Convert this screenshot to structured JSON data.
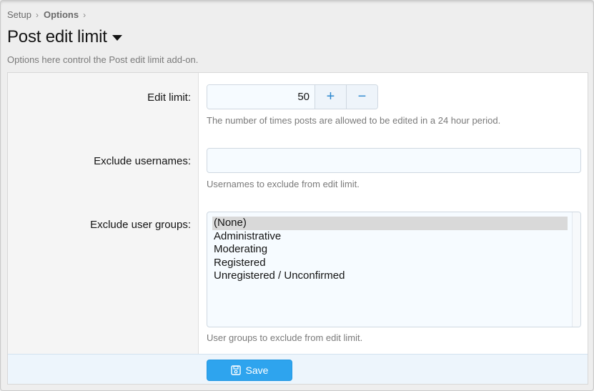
{
  "breadcrumb": {
    "items": [
      "Setup",
      "Options"
    ],
    "separator": "›"
  },
  "header": {
    "title": "Post edit limit",
    "description": "Options here control the Post edit limit add-on."
  },
  "options": {
    "edit_limit": {
      "label": "Edit limit:",
      "value": "50",
      "increment_label": "+",
      "decrement_label": "−",
      "explain": "The number of times posts are allowed to be edited in a 24 hour period."
    },
    "exclude_usernames": {
      "label": "Exclude usernames:",
      "value": "",
      "placeholder": "",
      "explain": "Usernames to exclude from edit limit."
    },
    "exclude_user_groups": {
      "label": "Exclude user groups:",
      "options": [
        "(None)",
        "Administrative",
        "Moderating",
        "Registered",
        "Unregistered / Unconfirmed"
      ],
      "selected": "(None)",
      "explain": "User groups to exclude from edit limit."
    }
  },
  "footer": {
    "save_label": "Save",
    "save_icon": "floppy-disk-icon"
  },
  "colors": {
    "accent": "#2ea4ee",
    "link_blue": "#2d88cf",
    "input_bg": "#f6fbff",
    "footer_bg": "#edf5fc"
  }
}
